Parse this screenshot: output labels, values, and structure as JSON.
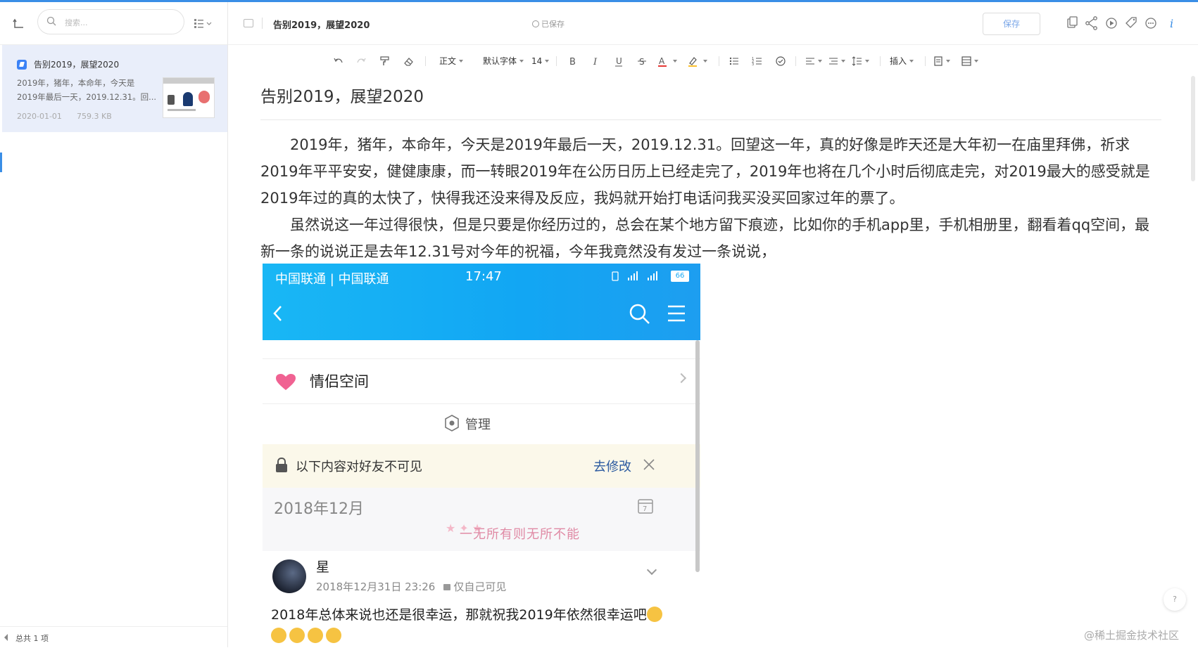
{
  "sidebar": {
    "search_placeholder": "搜索...",
    "note": {
      "title": "告别2019，展望2020",
      "snippet_line1": "2019年，猪年，本命年，今天是",
      "snippet_line2": "2019年最后一天，2019.12.31。回...",
      "date": "2020-01-01",
      "size": "759.3 KB"
    },
    "footer_count": "总共 1 项"
  },
  "header": {
    "title": "告别2019，展望2020",
    "saved_status": "已保存",
    "save_label": "保存"
  },
  "toolbar": {
    "paragraph_style": "正文",
    "font_family": "默认字体",
    "font_size": "14",
    "insert_label": "插入"
  },
  "document": {
    "title": "告别2019，展望2020",
    "paragraphs": [
      "2019年，猪年，本命年，今天是2019年最后一天，2019.12.31。回望这一年，真的好像是昨天还是大年初一在庙里拜佛，祈求2019年平平安安，健健康康，而一转眼2019年在公历日历上已经走完了，2019年也将在几个小时后彻底走完，对2019最大的感受就是2019年过的真的太快了，快得我还没来得及反应，我妈就开始打电话问我买没买回家过年的票了。",
      "虽然说这一年过得很快，但是只要是你经历过的，总会在某个地方留下痕迹，比如你的手机app里，手机相册里，翻看着qq空间，最新一条的说说正是去年12.31号对今年的祝福，今年我竟然没有发过一条说说，"
    ]
  },
  "phone": {
    "carrier": "中国联通 | 中国联通",
    "time": "17:47",
    "battery": "66",
    "couple_space": "情侣空间",
    "manage": "管理",
    "notice": "以下内容对好友不可见",
    "modify": "去修改",
    "month": "2018年12月",
    "banner": "一无所有则无所不能",
    "post_name": "星",
    "post_time": "2018年12月31日 23:26",
    "post_visibility": "仅自己可见",
    "post_text": "2018年总体来说也还是很幸运，那就祝我2019年依然很幸运吧"
  },
  "help": "?",
  "watermark": "@稀土掘金技术社区",
  "colors": {
    "accent": "#3a8ee6",
    "selected_item_bg": "#e9eefa",
    "phone_header": "#19b7f5"
  }
}
